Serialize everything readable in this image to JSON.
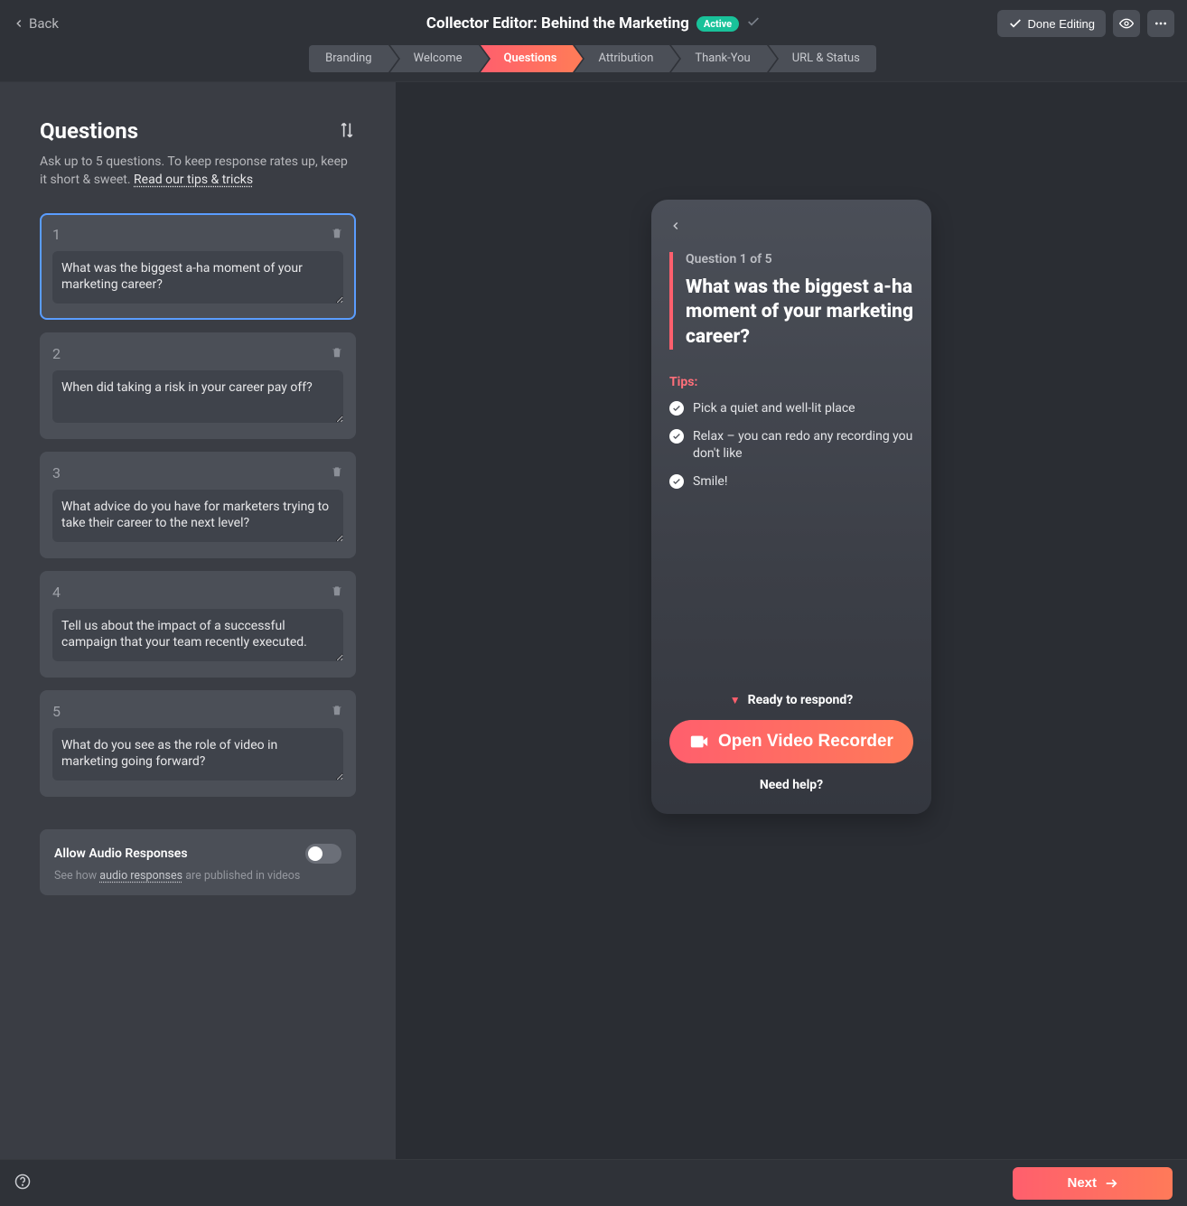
{
  "header": {
    "back_label": "Back",
    "title": "Collector Editor: Behind the Marketing",
    "status_badge": "Active",
    "done_label": "Done Editing"
  },
  "stepper": {
    "items": [
      {
        "label": "Branding"
      },
      {
        "label": "Welcome"
      },
      {
        "label": "Questions"
      },
      {
        "label": "Attribution"
      },
      {
        "label": "Thank-You"
      },
      {
        "label": "URL & Status"
      }
    ],
    "active_index": 2
  },
  "panel": {
    "title": "Questions",
    "help_text": "Ask up to 5 questions. To keep response rates up, keep it short & sweet. ",
    "help_link": "Read our tips & tricks"
  },
  "questions": [
    {
      "num": "1",
      "text": "What was the biggest a-ha moment of your marketing career?"
    },
    {
      "num": "2",
      "text": "When did taking a risk in your career pay off?"
    },
    {
      "num": "3",
      "text": "What advice do you have for marketers trying to take their career to the next level?"
    },
    {
      "num": "4",
      "text": "Tell us about the impact of a successful campaign that your team recently executed."
    },
    {
      "num": "5",
      "text": "What do you see as the role of video in marketing going forward?"
    }
  ],
  "selected_question_index": 0,
  "audio": {
    "title": "Allow Audio Responses",
    "sub_pre": "See how ",
    "sub_link": "audio responses",
    "sub_post": " are published in videos",
    "enabled": false
  },
  "preview": {
    "counter": "Question 1 of 5",
    "question": "What was the biggest a-ha moment of your marketing career?",
    "tips_heading": "Tips:",
    "tips": [
      "Pick a quiet and well-lit place",
      "Relax – you can redo any recording you don't like",
      "Smile!"
    ],
    "ready_label": "Ready to respond?",
    "cta_label": "Open Video Recorder",
    "need_help": "Need help?"
  },
  "footer": {
    "next_label": "Next"
  }
}
